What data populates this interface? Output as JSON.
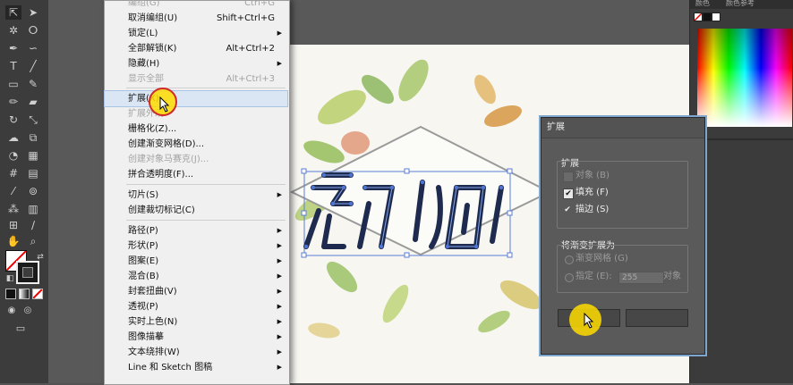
{
  "colors": {
    "menu_bg": "#f0f0f0",
    "menu_highlight": "#dbe6f4",
    "dialog_bg": "#5a5a5a",
    "canvas": "#f7f6f1",
    "cursor_highlight": "#ffdc00",
    "artwork_stroke": "#1e2b4f"
  },
  "menu": {
    "items": [
      {
        "label": "编组(G)",
        "shortcut": "Ctrl+G",
        "disabled": true
      },
      {
        "label": "取消编组(U)",
        "shortcut": "Shift+Ctrl+G"
      },
      {
        "label": "锁定(L)",
        "submenu": true
      },
      {
        "label": "全部解锁(K)",
        "shortcut": "Alt+Ctrl+2"
      },
      {
        "label": "隐藏(H)",
        "submenu": true
      },
      {
        "label": "显示全部",
        "shortcut": "Alt+Ctrl+3",
        "disabled": true
      },
      {
        "label": "扩展(X)...",
        "highlighted": true
      },
      {
        "label": "扩展外观",
        "disabled": true
      },
      {
        "label": "栅格化(Z)..."
      },
      {
        "label": "创建渐变网格(D)..."
      },
      {
        "label": "创建对象马赛克(J)...",
        "disabled": true
      },
      {
        "label": "拼合透明度(F)..."
      },
      {
        "label": "切片(S)",
        "submenu": true
      },
      {
        "label": "创建裁切标记(C)"
      },
      {
        "label": "路径(P)",
        "submenu": true
      },
      {
        "label": "形状(P)",
        "submenu": true
      },
      {
        "label": "图案(E)",
        "submenu": true
      },
      {
        "label": "混合(B)",
        "submenu": true
      },
      {
        "label": "封套扭曲(V)",
        "submenu": true
      },
      {
        "label": "透视(P)",
        "submenu": true
      },
      {
        "label": "实时上色(N)",
        "submenu": true
      },
      {
        "label": "图像描摹",
        "submenu": true
      },
      {
        "label": "文本绕排(W)",
        "submenu": true
      },
      {
        "label": "Line 和 Sketch 图稿",
        "submenu": true
      }
    ]
  },
  "dialog": {
    "title": "扩展",
    "expand_group_label": "扩展",
    "object_label": "对象 (B)",
    "fill_label": "填充 (F)",
    "stroke_label": "描边 (S)",
    "object_checked": false,
    "fill_checked": true,
    "stroke_checked": true,
    "gradient_group_label": "将渐变扩展为",
    "gradient_mesh_label": "渐变网格 (G)",
    "specify_label": "指定 (E):",
    "specify_value": "255",
    "objects_unit": "对象"
  },
  "right_panel": {
    "tab_color": "颜色",
    "tab_color_guide": "颜色参考"
  },
  "tools": {
    "icons": [
      "selection-tool-icon",
      "direct-selection-tool-icon",
      "magic-wand-tool-icon",
      "lasso-tool-icon",
      "pen-tool-icon",
      "curvature-tool-icon",
      "type-tool-icon",
      "line-tool-icon",
      "rectangle-tool-icon",
      "paintbrush-tool-icon",
      "pencil-tool-icon",
      "eraser-tool-icon",
      "rotate-tool-icon",
      "scale-tool-icon",
      "warp-tool-icon",
      "free-transform-tool-icon",
      "shape-builder-tool-icon",
      "perspective-grid-tool-icon",
      "mesh-tool-icon",
      "gradient-tool-icon",
      "eyedropper-tool-icon",
      "blend-tool-icon",
      "symbol-sprayer-tool-icon",
      "column-graph-tool-icon",
      "artboard-tool-icon",
      "slice-tool-icon",
      "hand-tool-icon",
      "zoom-tool-icon"
    ]
  }
}
